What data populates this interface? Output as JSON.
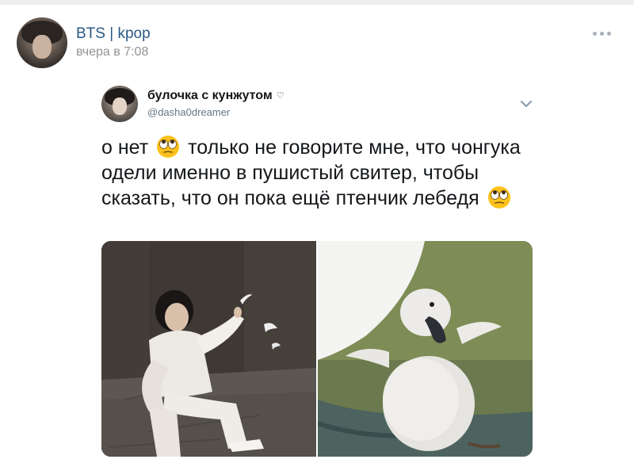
{
  "post": {
    "author": "BTS | kpop",
    "time": "вчера в 7:08"
  },
  "tweet": {
    "name": "булочка с кунжутом",
    "heart": "♡",
    "handle": "@dasha0dreamer",
    "text_part1": "о нет",
    "text_part2": "только не говорите мне, что чонгука одели именно в пушистый свитер, чтобы сказать, что он пока ещё птенчик лебедя"
  },
  "icons": {
    "more": "more-icon",
    "chevron": "chevron-down-icon",
    "emoji": "eyes-rolling-emoji"
  },
  "colors": {
    "author_link": "#2a5885",
    "meta_gray": "#939393",
    "tweet_text": "#14171a",
    "handle_gray": "#657786"
  }
}
